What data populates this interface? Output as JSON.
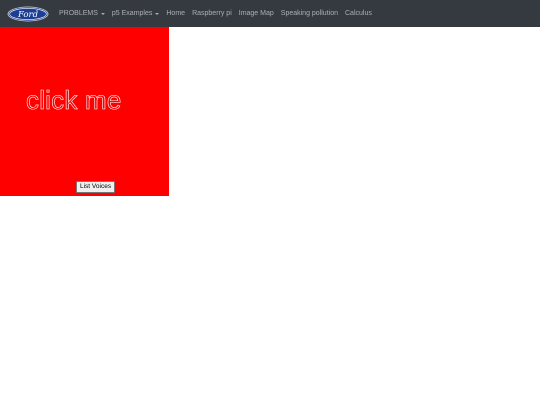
{
  "navbar": {
    "brand_text": "Ford",
    "items": [
      {
        "label": "PROBLEMS",
        "dropdown": true
      },
      {
        "label": "p5 Examples",
        "dropdown": true
      },
      {
        "label": "Home",
        "dropdown": false
      },
      {
        "label": "Raspberry pi",
        "dropdown": false
      },
      {
        "label": "Image Map",
        "dropdown": false
      },
      {
        "label": "Speaking pollution",
        "dropdown": false
      },
      {
        "label": "Calculus",
        "dropdown": false
      }
    ]
  },
  "canvas": {
    "text": "click me",
    "background_color": "#ff0000"
  },
  "list_voices_button": {
    "label": "List Voices"
  },
  "colors": {
    "navbar_bg": "#343a40",
    "ford_blue": "#1c3f94",
    "canvas_red": "#ff0000"
  }
}
